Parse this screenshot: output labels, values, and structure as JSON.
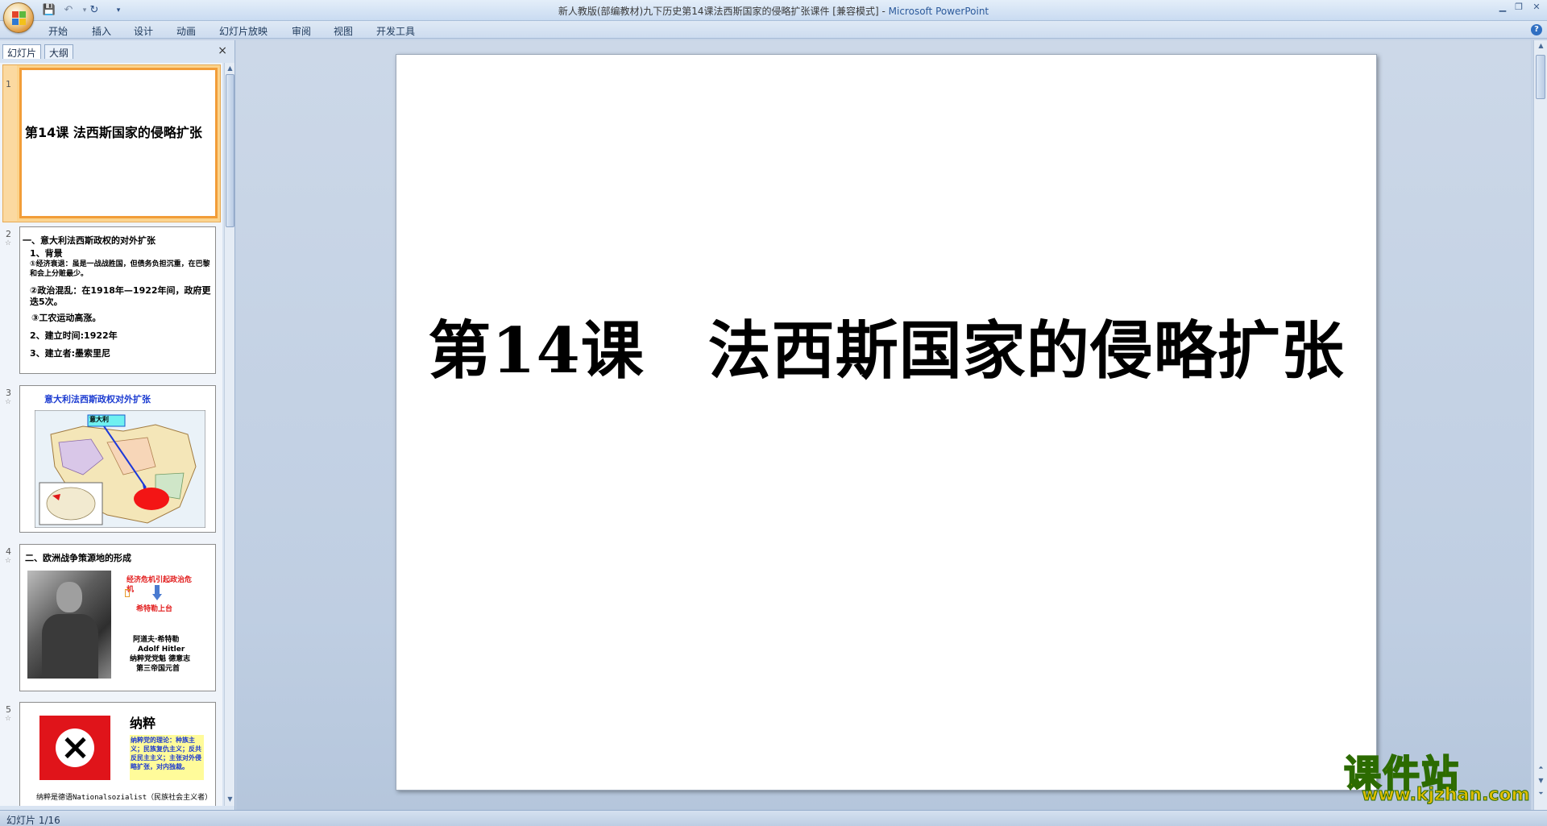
{
  "window": {
    "title": "新人教版(部编教材)九下历史第14课法西斯国家的侵略扩张课件 [兼容模式] - ",
    "app_name": "Microsoft PowerPoint"
  },
  "quick_access": {
    "save": "save-icon",
    "undo": "undo-icon",
    "redo": "redo-icon"
  },
  "ribbon": {
    "tabs": [
      "开始",
      "插入",
      "设计",
      "动画",
      "幻灯片放映",
      "审阅",
      "视图",
      "开发工具"
    ]
  },
  "left_pane": {
    "tabs": [
      "幻灯片",
      "大纲"
    ],
    "close": "×"
  },
  "thumbnails": {
    "s1": {
      "num": "1",
      "title": "第14课  法西斯国家的侵略扩张"
    },
    "s2": {
      "num": "2",
      "lines": [
        "一、意大利法西斯政权的对外扩张",
        "1、背景",
        "①经济衰退：虽是一战战胜国，但债务负担沉重，在巴黎和会上分赃最少。",
        "②政治混乱：在1918年—1922年间，政府更迭5次。",
        "③工农运动高涨。",
        "2、建立时间:1922年",
        "3、建立者:墨索里尼"
      ]
    },
    "s3": {
      "num": "3",
      "title": "意大利法西斯政权对外扩张",
      "label": "意大利"
    },
    "s4": {
      "num": "4",
      "title": "二、欧洲战争策源地的形成",
      "red1": "经济危机引起政治危机",
      "red2": "希特勒上台",
      "caption": [
        "阿道夫·希特勒",
        "Adolf Hitler",
        "纳粹党党魁 德意志",
        "第三帝国元首"
      ]
    },
    "s5": {
      "num": "5",
      "title": "纳粹",
      "box": "纳粹党的理论：种族主义；民族复仇主义；反共反民主主义；主张对外侵略扩张，对内独裁。",
      "bottom": "纳粹是德语Nationalsozialist（民族社会主义者）"
    }
  },
  "slide": {
    "title": "第14课　法西斯国家的侵略扩张"
  },
  "watermark": {
    "main": "课件站",
    "url": "www.kjzhan.com"
  },
  "status": {
    "text": "幻灯片 1/16"
  }
}
